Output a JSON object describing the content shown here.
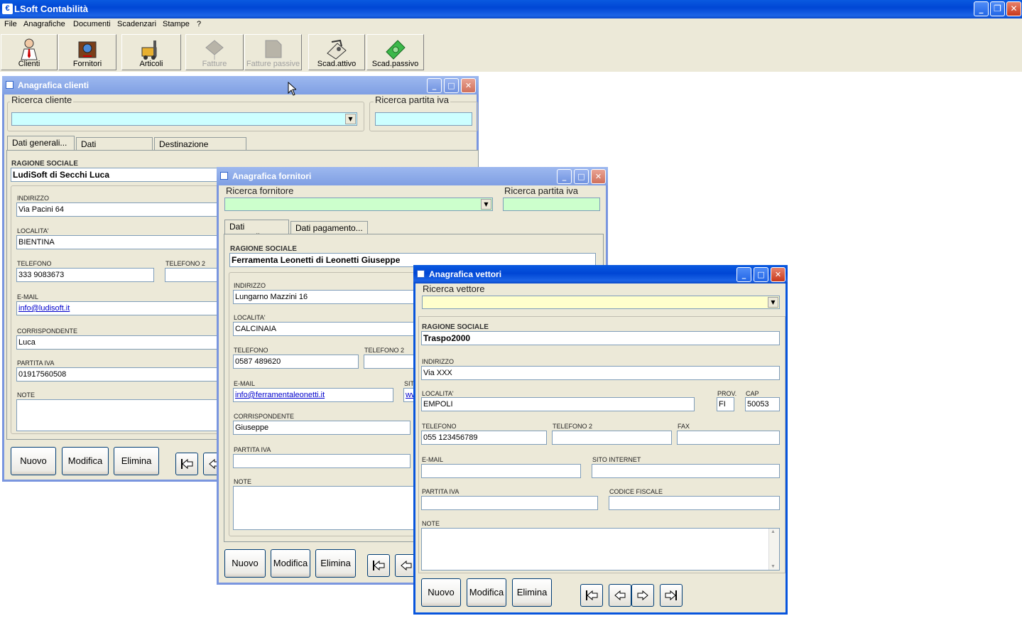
{
  "app": {
    "title": "LSoft Contabilità"
  },
  "menu": [
    "File",
    "Anagrafiche",
    "Documenti",
    "Scadenzari",
    "Stampe",
    "?"
  ],
  "toolbar": [
    {
      "label": "Clienti",
      "enabled": true
    },
    {
      "label": "Fornitori",
      "enabled": true
    },
    {
      "label": "Articoli",
      "enabled": true
    },
    {
      "label": "Fatture",
      "enabled": false
    },
    {
      "label": "Fatture passive",
      "enabled": false
    },
    {
      "label": "Scad.attivo",
      "enabled": true
    },
    {
      "label": "Scad.passivo",
      "enabled": true
    }
  ],
  "clienti": {
    "title": "Anagrafica clienti",
    "search_label": "Ricerca cliente",
    "piva_label": "Ricerca partita iva",
    "tabs": [
      "Dati generali...",
      "Dati pagamento...",
      "Destinazione merce..."
    ],
    "ragione_label": "RAGIONE SOCIALE",
    "ragione": "LudiSoft di Secchi Luca",
    "indirizzo_label": "INDIRIZZO",
    "indirizzo": "Via Pacini 64",
    "localita_label": "LOCALITA'",
    "localita": "BIENTINA",
    "telefono_label": "TELEFONO",
    "telefono": "333 9083673",
    "telefono2_label": "TELEFONO 2",
    "email_label": "E-MAIL",
    "email": "info@ludisoft.it",
    "corrispondente_label": "CORRISPONDENTE",
    "corrispondente": "Luca",
    "partitaiva_label": "PARTITA IVA",
    "partitaiva": "01917560508",
    "note_label": "NOTE",
    "buttons": {
      "nuovo": "Nuovo",
      "modifica": "Modifica",
      "elimina": "Elimina"
    }
  },
  "fornitori": {
    "title": "Anagrafica fornitori",
    "search_label": "Ricerca fornitore",
    "piva_label": "Ricerca partita iva",
    "tabs": [
      "Dati generali...",
      "Dati pagamento..."
    ],
    "ragione_label": "RAGIONE SOCIALE",
    "ragione": "Ferramenta Leonetti di Leonetti Giuseppe",
    "indirizzo_label": "INDIRIZZO",
    "indirizzo": "Lungarno Mazzini 16",
    "localita_label": "LOCALITA'",
    "localita": "CALCINAIA",
    "telefono_label": "TELEFONO",
    "telefono": "0587 489620",
    "telefono2_label": "TELEFONO 2",
    "email_label": "E-MAIL",
    "email": "info@ferramentaleonetti.it",
    "sito_label": "SITO",
    "sito": "ww",
    "corrispondente_label": "CORRISPONDENTE",
    "corrispondente": "Giuseppe",
    "partitaiva_label": "PARTITA IVA",
    "note_label": "NOTE",
    "buttons": {
      "nuovo": "Nuovo",
      "modifica": "Modifica",
      "elimina": "Elimina"
    }
  },
  "vettori": {
    "title": "Anagrafica vettori",
    "search_label": "Ricerca vettore",
    "ragione_label": "RAGIONE SOCIALE",
    "ragione": "Traspo2000",
    "indirizzo_label": "INDIRIZZO",
    "indirizzo": "Via XXX",
    "localita_label": "LOCALITA'",
    "localita": "EMPOLI",
    "prov_label": "PROV.",
    "prov": "FI",
    "cap_label": "CAP",
    "cap": "50053",
    "telefono_label": "TELEFONO",
    "telefono": "055 123456789",
    "telefono2_label": "TELEFONO 2",
    "fax_label": "FAX",
    "email_label": "E-MAIL",
    "sito_label": "SITO INTERNET",
    "partitaiva_label": "PARTITA IVA",
    "codfisc_label": "CODICE FISCALE",
    "note_label": "NOTE",
    "buttons": {
      "nuovo": "Nuovo",
      "modifica": "Modifica",
      "elimina": "Elimina"
    }
  },
  "colors": {
    "cyan_field": "#ccffff",
    "green_field": "#ccffcc",
    "yellow_field": "#ffffcc",
    "xp_blue": "#0046d5"
  }
}
